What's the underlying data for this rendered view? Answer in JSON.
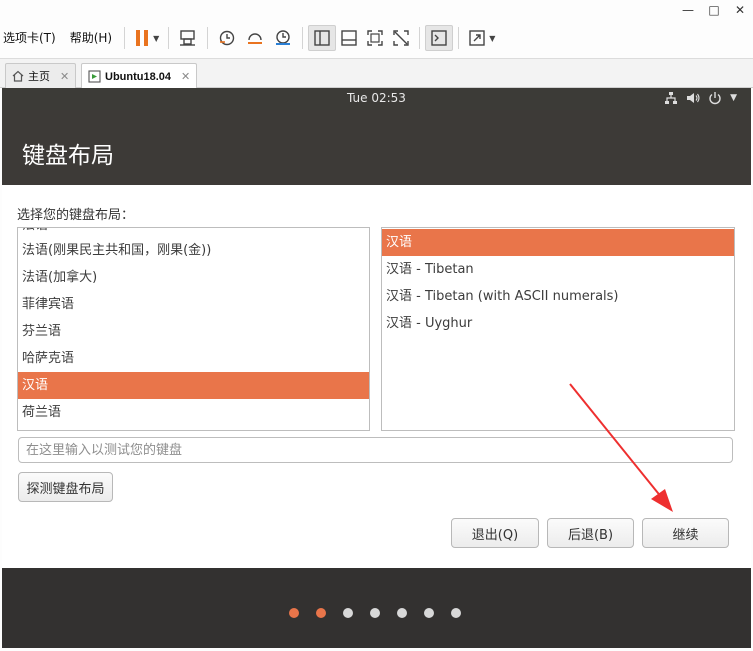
{
  "host": {
    "window_controls": [
      "—",
      "□",
      "✕"
    ],
    "menu": [
      {
        "label": "选项卡(T)"
      },
      {
        "label": "帮助(H)"
      }
    ],
    "tabs": [
      {
        "label": "主页",
        "close": "✕",
        "icon": "home-icon"
      },
      {
        "label": "Ubuntu18.04",
        "close": "✕",
        "icon": "vm-icon"
      }
    ],
    "colors": {
      "pause_orange": "#e9731f",
      "accent": "#e9754a"
    }
  },
  "guest": {
    "clock": "Tue 02:53",
    "tray_icons": [
      "network-icon",
      "volume-icon",
      "power-icon",
      "chevron-down-icon"
    ],
    "header_title": "键盘布局",
    "prompt": "选择您的键盘布局：",
    "left_list": {
      "cut_item": "法语",
      "items": [
        {
          "label": "法语(刚果民主共和国，刚果(金))",
          "selected": false
        },
        {
          "label": "法语(加拿大)",
          "selected": false
        },
        {
          "label": "菲律宾语",
          "selected": false
        },
        {
          "label": "芬兰语",
          "selected": false
        },
        {
          "label": "哈萨克语",
          "selected": false
        },
        {
          "label": "汉语",
          "selected": true
        },
        {
          "label": "荷兰语",
          "selected": false
        }
      ]
    },
    "right_list": {
      "items": [
        {
          "label": "汉语",
          "selected": true
        },
        {
          "label": "汉语 - Tibetan",
          "selected": false
        },
        {
          "label": "汉语 - Tibetan (with ASCII numerals)",
          "selected": false
        },
        {
          "label": "汉语 - Uyghur",
          "selected": false
        }
      ]
    },
    "test_input": {
      "placeholder": "在这里输入以测试您的键盘",
      "value": ""
    },
    "buttons": {
      "detect": "探测键盘布局",
      "quit": "退出(Q)",
      "back": "后退(B)",
      "continue": "继续"
    },
    "progress": {
      "total_steps": 7,
      "completed_steps": 2,
      "active_color": "#e9754a",
      "inactive_color": "#d8d8d8"
    }
  }
}
